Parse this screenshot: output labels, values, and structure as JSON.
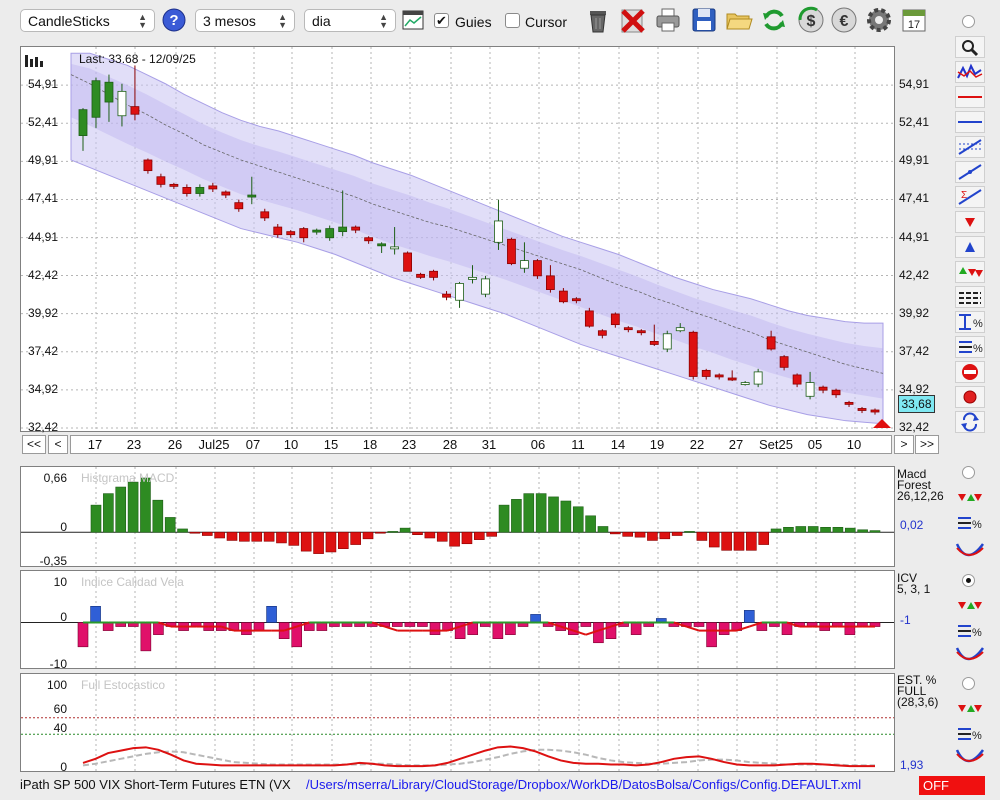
{
  "toolbar": {
    "chart_type": "CandleSticks",
    "period": "3 mesos",
    "interval": "dia",
    "guies_label": "Guies",
    "guies_checked": true,
    "cursor_label": "Cursor",
    "cursor_checked": false,
    "help_glyph": "?",
    "calendar_day": "17",
    "icons": [
      "help-icon",
      "chart-window-icon",
      "trash-icon",
      "delete-x-icon",
      "print-icon",
      "save-disk-icon",
      "open-folder-icon",
      "refresh-icon",
      "currency-dollar-icon",
      "currency-euro-icon",
      "gear-icon",
      "calendar-icon"
    ]
  },
  "main_chart": {
    "last_label": "Last: 33.68 - 12/09/25",
    "current_value": "33,68",
    "y_ticks": [
      "54,91",
      "52,41",
      "49,91",
      "47,41",
      "44,91",
      "42,42",
      "39,92",
      "37,42",
      "34,92",
      "32,42"
    ],
    "x_labels": [
      "17",
      "23",
      "26",
      "Jul25",
      "07",
      "10",
      "15",
      "18",
      "23",
      "28",
      "31",
      "06",
      "11",
      "14",
      "19",
      "22",
      "27",
      "Set25",
      "05",
      "10"
    ],
    "nav": {
      "first": "<<",
      "prev": "<",
      "next": ">",
      "last": ">>"
    },
    "colors": {
      "up": "#2e8b22",
      "down": "#dd1111",
      "band": "#c9c2f2"
    }
  },
  "macd": {
    "title": "Histgrama MACD",
    "side_name": [
      "Macd",
      "Forest"
    ],
    "params": "26,12,26",
    "value": "0,02",
    "y_ticks": [
      "0,66",
      "0",
      "-0,35"
    ]
  },
  "icv": {
    "title": "Indice Calidad Vela",
    "side_name": "ICV",
    "params": "5, 3, 1",
    "value": "-1",
    "y_ticks": [
      "10",
      "0",
      "-10"
    ]
  },
  "stoch": {
    "title": "Full Estocastico",
    "side_name": [
      "EST. %",
      "FULL"
    ],
    "params": "(28,3,6)",
    "value": "1,93",
    "y_ticks": [
      "100",
      "60",
      "40",
      "0"
    ]
  },
  "right_tools": [
    "zoom-icon",
    "indicator-chart-icon",
    "horizontal-line-red-icon",
    "horizontal-line-blue-icon",
    "fibonacci-icon",
    "trend-line-icon",
    "sigma-line-icon",
    "sell-arrow-icon",
    "buy-arrow-icon",
    "buy-sell-arrows-icon",
    "grid-lines-icon",
    "percent-range-icon",
    "percent-lines-icon",
    "no-entry-icon",
    "record-icon",
    "swap-icon"
  ],
  "status": {
    "instrument": "iPath SP 500 VIX Short-Term Futures ETN (VX",
    "path": "/Users/mserra/Library/CloudStorage/Dropbox/WorkDB/DatosBolsa/Configs/Config.DEFAULT.xml",
    "off_label": "OFF"
  },
  "chart_data": [
    {
      "type": "candlestick",
      "ylim": [
        32.42,
        57.41
      ],
      "y_ticks": [
        54.91,
        52.41,
        49.91,
        47.41,
        44.91,
        42.42,
        39.92,
        37.42,
        34.92,
        32.42
      ],
      "x_labels": [
        "17",
        "23",
        "26",
        "Jul25",
        "07",
        "10",
        "15",
        "18",
        "23",
        "28",
        "31",
        "06",
        "11",
        "14",
        "19",
        "22",
        "27",
        "Set25",
        "05",
        "10"
      ],
      "candles": [
        [
          51.6,
          53.3,
          50.6,
          53.4
        ],
        [
          52.8,
          55.2,
          52.1,
          55.4
        ],
        [
          53.8,
          55.1,
          52.5,
          55.6
        ],
        [
          52.9,
          54.5,
          52.2,
          55.0
        ],
        [
          53.5,
          53.0,
          52.6,
          56.2
        ],
        [
          50.0,
          49.3,
          49.1,
          50.1
        ],
        [
          48.9,
          48.4,
          48.2,
          49.1
        ],
        [
          48.4,
          48.3,
          48.1,
          48.5
        ],
        [
          48.2,
          47.8,
          47.6,
          48.4
        ],
        [
          47.8,
          48.2,
          47.6,
          48.4
        ],
        [
          48.3,
          48.1,
          47.9,
          48.5
        ],
        [
          47.9,
          47.7,
          47.5,
          48.0
        ],
        [
          47.2,
          46.8,
          46.6,
          47.4
        ],
        [
          47.6,
          47.7,
          47.1,
          48.9
        ],
        [
          46.6,
          46.2,
          46.0,
          46.8
        ],
        [
          45.6,
          45.1,
          44.9,
          45.8
        ],
        [
          45.3,
          45.1,
          44.9,
          45.4
        ],
        [
          45.5,
          44.9,
          44.6,
          45.6
        ],
        [
          45.3,
          45.4,
          45.1,
          45.5
        ],
        [
          44.9,
          45.5,
          44.7,
          45.7
        ],
        [
          45.3,
          45.6,
          45.0,
          48.0
        ],
        [
          45.6,
          45.4,
          45.2,
          45.7
        ],
        [
          44.9,
          44.7,
          44.5,
          45.0
        ],
        [
          44.4,
          44.5,
          43.9,
          44.6
        ],
        [
          44.2,
          44.3,
          43.8,
          45.6
        ],
        [
          43.9,
          42.7,
          42.7,
          44.0
        ],
        [
          42.5,
          42.3,
          42.2,
          42.6
        ],
        [
          42.7,
          42.3,
          42.1,
          42.8
        ],
        [
          41.2,
          41.0,
          40.8,
          41.4
        ],
        [
          40.8,
          41.9,
          40.3,
          42.0
        ],
        [
          42.2,
          42.3,
          41.9,
          43.1
        ],
        [
          41.2,
          42.2,
          41.0,
          42.4
        ],
        [
          44.6,
          46.0,
          44.1,
          47.4
        ],
        [
          44.8,
          43.2,
          43.1,
          44.9
        ],
        [
          42.9,
          43.4,
          42.6,
          44.6
        ],
        [
          43.4,
          42.4,
          42.2,
          43.5
        ],
        [
          42.4,
          41.5,
          41.3,
          43.1
        ],
        [
          41.4,
          40.7,
          40.6,
          41.6
        ],
        [
          40.9,
          40.8,
          40.6,
          41.0
        ],
        [
          40.1,
          39.1,
          39.0,
          40.3
        ],
        [
          38.8,
          38.5,
          38.3,
          38.9
        ],
        [
          39.9,
          39.2,
          39.0,
          40.0
        ],
        [
          39.0,
          38.9,
          38.7,
          39.1
        ],
        [
          38.8,
          38.7,
          38.5,
          38.9
        ],
        [
          38.1,
          37.9,
          37.8,
          39.2
        ],
        [
          37.6,
          38.6,
          37.4,
          38.8
        ],
        [
          38.8,
          39.0,
          38.7,
          39.3
        ],
        [
          38.7,
          35.8,
          35.6,
          38.8
        ],
        [
          36.2,
          35.8,
          35.6,
          36.3
        ],
        [
          35.9,
          35.8,
          35.6,
          36.0
        ],
        [
          35.7,
          35.6,
          35.5,
          36.2
        ],
        [
          35.4,
          35.4,
          35.2,
          35.5
        ],
        [
          35.3,
          36.1,
          35.1,
          36.3
        ],
        [
          38.4,
          37.6,
          37.5,
          38.8
        ],
        [
          37.1,
          36.4,
          36.2,
          37.2
        ],
        [
          35.9,
          35.3,
          35.1,
          36.0
        ],
        [
          34.5,
          35.4,
          34.3,
          36.1
        ],
        [
          35.1,
          34.9,
          34.7,
          35.2
        ],
        [
          34.9,
          34.6,
          34.4,
          35.0
        ],
        [
          34.1,
          34.0,
          33.8,
          34.2
        ],
        [
          33.7,
          33.6,
          33.4,
          33.8
        ],
        [
          33.6,
          33.5,
          33.3,
          33.7
        ]
      ],
      "band": {
        "mid": [
          55.6,
          55.0,
          54.3,
          53.6,
          53.0,
          52.3,
          51.7,
          51.0,
          50.5,
          50.0,
          49.6,
          49.2,
          48.8,
          48.4,
          48.0,
          47.6,
          47.1,
          46.7,
          46.3,
          45.9,
          45.6,
          45.2,
          44.8,
          44.4,
          44.0,
          43.6,
          43.2,
          42.8,
          42.3,
          41.8,
          41.4,
          40.9,
          40.5,
          40.0,
          39.6,
          39.1,
          38.7,
          38.2,
          37.8,
          37.4,
          37.0,
          36.6,
          36.3,
          36.0
        ],
        "upper": [
          57.0,
          57.0,
          56.6,
          56.2,
          55.6,
          55.0,
          54.3,
          53.7,
          53.1,
          52.6,
          52.2,
          51.9,
          51.5,
          51.1,
          50.7,
          50.3,
          49.8,
          49.4,
          49.0,
          48.5,
          48.0,
          47.5,
          47.0,
          46.5,
          46.0,
          45.5,
          45.0,
          44.6,
          44.2,
          43.8,
          43.3,
          42.8,
          42.3,
          41.9,
          41.5,
          41.2,
          40.9,
          40.5,
          40.1,
          39.8,
          39.6,
          39.4,
          39.3,
          39.3
        ],
        "lower": [
          50.0,
          49.5,
          49.0,
          48.5,
          48.0,
          47.5,
          47.0,
          46.5,
          46.0,
          45.5,
          45.2,
          44.9,
          44.6,
          44.2,
          43.8,
          43.3,
          42.8,
          42.3,
          41.9,
          41.5,
          41.1,
          40.7,
          40.3,
          39.9,
          39.4,
          38.9,
          38.4,
          37.9,
          37.5,
          37.1,
          36.7,
          36.3,
          35.9,
          35.5,
          35.1,
          34.7,
          34.3,
          33.9,
          33.6,
          33.3,
          33.1,
          32.9,
          32.8,
          32.7
        ]
      }
    },
    {
      "type": "bar",
      "title": "Histgrama MACD",
      "ylim": [
        -0.35,
        0.66
      ],
      "values": [
        0.33,
        0.47,
        0.55,
        0.61,
        0.66,
        0.39,
        0.18,
        0.04,
        -0.01,
        -0.04,
        -0.07,
        -0.1,
        -0.11,
        -0.11,
        -0.11,
        -0.13,
        -0.16,
        -0.23,
        -0.26,
        -0.24,
        -0.2,
        -0.15,
        -0.08,
        -0.01,
        0.01,
        0.05,
        -0.03,
        -0.07,
        -0.11,
        -0.17,
        -0.14,
        -0.09,
        -0.05,
        0.33,
        0.4,
        0.47,
        0.47,
        0.43,
        0.38,
        0.31,
        0.2,
        0.07,
        -0.02,
        -0.05,
        -0.06,
        -0.1,
        -0.08,
        -0.04,
        0.01,
        -0.1,
        -0.18,
        -0.22,
        -0.22,
        -0.22,
        -0.15,
        0.04,
        0.06,
        0.07,
        0.07,
        0.06,
        0.06,
        0.05,
        0.03,
        0.02
      ],
      "signal_line": 0
    },
    {
      "type": "bar",
      "title": "Indice Calidad Vela",
      "ylim": [
        -10,
        10
      ],
      "values": [
        -6,
        4,
        -2,
        -1,
        -1,
        -7,
        -3,
        -1,
        -2,
        -1,
        -2,
        -2,
        -2,
        -3,
        -2,
        4,
        -4,
        -6,
        -2,
        -2,
        -1,
        -1,
        -1,
        -1,
        -1,
        -1,
        -1,
        -1,
        -3,
        -2,
        -4,
        -3,
        -1,
        -4,
        -3,
        -1,
        2,
        -1,
        -2,
        -3,
        -1,
        -5,
        -4,
        -1,
        -3,
        -1,
        1,
        -1,
        -1,
        -1,
        -6,
        -3,
        -2,
        3,
        -2,
        -1,
        -3,
        -1,
        -1,
        -2,
        -1,
        -3,
        -1,
        -1
      ],
      "line": [
        0,
        0,
        0,
        0,
        0,
        0,
        0,
        -1,
        -1,
        -1,
        -1,
        -1,
        -2,
        -2,
        -2,
        -2,
        -2,
        -1,
        0,
        0,
        0,
        0,
        0,
        0,
        -1,
        -2,
        -2,
        -2,
        -2,
        -2,
        -1,
        0,
        0,
        0,
        0,
        0,
        0,
        0,
        -1,
        -2,
        -3,
        -2,
        -1,
        0,
        0,
        0,
        0,
        0,
        -1,
        -2,
        -2,
        -2,
        -2,
        -1,
        0,
        0,
        0,
        -1,
        -1,
        -1,
        -1,
        -1,
        -1,
        -1
      ]
    },
    {
      "type": "line",
      "title": "Full Estocastico",
      "ylim": [
        0,
        100
      ],
      "y_ticks": [
        100,
        60,
        40,
        0
      ],
      "series": [
        {
          "values": [
            5,
            10,
            17,
            20,
            23,
            24,
            21,
            15,
            8,
            4,
            3,
            2,
            2,
            2,
            2,
            2,
            2,
            2,
            2,
            2,
            2,
            3,
            5,
            4,
            2,
            1,
            1,
            1,
            2,
            5,
            10,
            15,
            20,
            24,
            25,
            23,
            19,
            13,
            8,
            5,
            4,
            4,
            3,
            3,
            2,
            3,
            6,
            10,
            12,
            13,
            10,
            6,
            3,
            2,
            2,
            2,
            3,
            4,
            4,
            3,
            2,
            1,
            1,
            1
          ]
        },
        {
          "values": [
            2,
            4,
            7,
            10,
            13,
            16,
            18,
            19,
            18,
            15,
            12,
            9,
            6,
            5,
            4,
            3,
            3,
            3,
            3,
            3,
            3,
            3,
            3,
            4,
            4,
            3,
            2,
            2,
            2,
            3,
            4,
            6,
            9,
            12,
            16,
            19,
            21,
            21,
            20,
            18,
            15,
            11,
            8,
            6,
            5,
            4,
            4,
            5,
            6,
            8,
            9,
            9,
            8,
            6,
            5,
            4,
            3,
            3,
            3,
            3,
            3,
            2,
            2,
            2
          ]
        }
      ]
    }
  ]
}
